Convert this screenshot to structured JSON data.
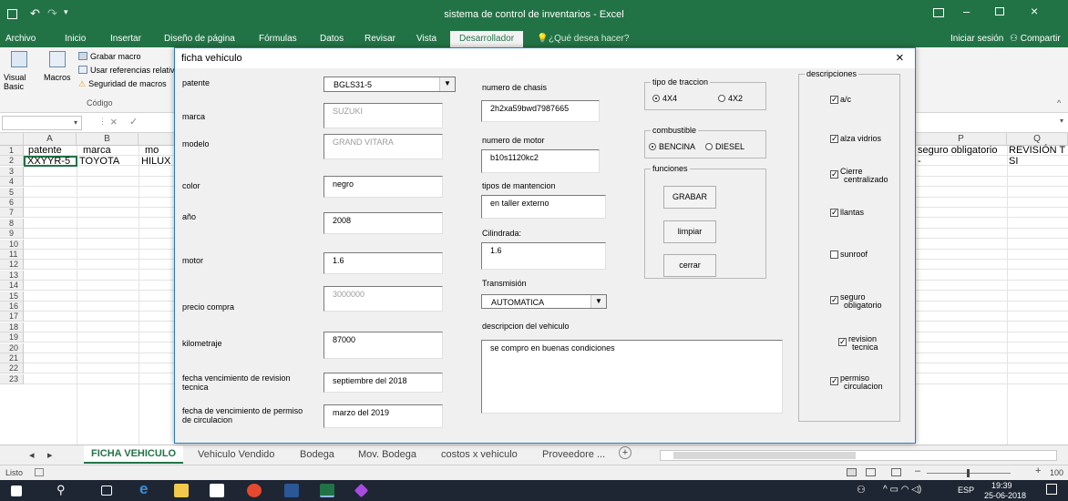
{
  "window": {
    "title": "sistema de control de inventarios - Excel"
  },
  "menu": {
    "items": [
      "Archivo",
      "Inicio",
      "Insertar",
      "Diseño de página",
      "Fórmulas",
      "Datos",
      "Revisar",
      "Vista",
      "Desarrollador"
    ],
    "tell_me": "¿Qué desea hacer?",
    "signin": "Iniciar sesión",
    "share": "Compartir"
  },
  "ribbon": {
    "visual_basic": "Visual Basic",
    "macros": "Macros",
    "record_macro": "Grabar macro",
    "relative_refs": "Usar referencias relativas",
    "macro_security": "Seguridad de macros",
    "group_label": "Código"
  },
  "formula": {
    "cancel": "×",
    "enter": "✓"
  },
  "sheet": {
    "col_a": "A",
    "col_b": "B",
    "col_p": "P",
    "col_q": "Q",
    "rows": [
      "1",
      "2",
      "3",
      "4",
      "5",
      "6",
      "7",
      "8",
      "9",
      "10",
      "11",
      "12",
      "13",
      "14",
      "15",
      "16",
      "17",
      "18",
      "19",
      "20",
      "21",
      "22",
      "23"
    ],
    "r1": {
      "a": "patente",
      "b": "marca",
      "c": "mo",
      "p": "seguro obligatorio",
      "q": "REVISIÓN T"
    },
    "r2": {
      "a": "XXYYR-5",
      "b": "TOYOTA",
      "c": "HILUX",
      "p": "-",
      "q": "SI"
    }
  },
  "tabs": {
    "items": [
      "FICHA VEHICULO",
      "Vehiculo Vendido",
      "Bodega",
      "Mov. Bodega",
      "costos x vehiculo",
      "Proveedore ..."
    ],
    "add": "+"
  },
  "status": {
    "ready": "Listo",
    "zoom": "100"
  },
  "taskbar": {
    "lang": "ESP",
    "time": "19:39",
    "date": "25-06-2018"
  },
  "dialog": {
    "title": "ficha vehiculo",
    "close": "×",
    "labels": {
      "patente": "patente",
      "marca": "marca",
      "modelo": "modelo",
      "color": "color",
      "anio": "año",
      "motor": "motor",
      "precio": "precio compra",
      "km": "kilometraje",
      "rev1": "fecha vencimiento de revision",
      "rev2": "tecnica",
      "perm1": "fecha de vencimiento de permiso",
      "perm2": "de circulacion",
      "chasis": "numero de chasis",
      "nmotor": "numero de motor",
      "mant": "tipos de mantencion",
      "cil": "Cilindrada:",
      "trans": "Transmisión",
      "desc": "descripcion del vehiculo"
    },
    "values": {
      "patente": "BGLS31-5",
      "marca": "SUZUKI",
      "modelo": "GRAND VITARA",
      "color": "negro",
      "anio": "2008",
      "motor": "1.6",
      "precio": "3000000",
      "km": "87000",
      "rev": "septiembre del 2018",
      "perm": "marzo del 2019",
      "chasis": "2h2xa59bwd7987665",
      "nmotor": "b10s1120kc2",
      "mant": "en taller externo",
      "cil": "1.6",
      "trans": "AUTOMATICA",
      "desc": "se compro en buenas condiciones"
    },
    "traccion": {
      "title": "tipo de traccion",
      "opt1": "4X4",
      "opt2": "4X2",
      "selected": "4X4"
    },
    "combustible": {
      "title": "combustible",
      "opt1": "BENCINA",
      "opt2": "DIESEL",
      "selected": "BENCINA"
    },
    "funciones": {
      "title": "funciones",
      "grabar": "GRABAR",
      "limpiar": "limpiar",
      "cerrar": "cerrar"
    },
    "descripciones": {
      "title": "descripciones",
      "items": [
        {
          "l1": "a/c",
          "l2": "",
          "checked": true
        },
        {
          "l1": "alza vidrios",
          "l2": "",
          "checked": true
        },
        {
          "l1": "Cierre",
          "l2": "centralizado",
          "checked": true
        },
        {
          "l1": "llantas",
          "l2": "",
          "checked": true
        },
        {
          "l1": "sunroof",
          "l2": "",
          "checked": false
        },
        {
          "l1": "seguro",
          "l2": "obligatorio",
          "checked": true
        },
        {
          "l1": "revision",
          "l2": "tecnica",
          "checked": true
        },
        {
          "l1": "permiso",
          "l2": "circulacion",
          "checked": true
        }
      ]
    }
  },
  "colors": {
    "excel_green": "#217346",
    "dialog_bg": "#f0f0f0",
    "taskbar": "#1e2633"
  }
}
